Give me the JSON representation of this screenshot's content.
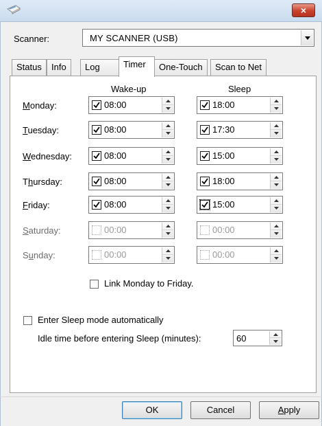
{
  "window": {
    "close_glyph": "×",
    "icon": "scanner-icon"
  },
  "scanner": {
    "label": "Scanner:",
    "value": "MY SCANNER (USB)"
  },
  "tabs": [
    {
      "label": "Status",
      "active": false
    },
    {
      "label": "Info",
      "active": false
    },
    {
      "label": "Log",
      "active": false
    },
    {
      "label": "Timer",
      "active": true
    },
    {
      "label": "One-Touch",
      "active": false
    },
    {
      "label": "Scan to Net",
      "active": false
    }
  ],
  "columns": {
    "wake": "Wake-up",
    "sleep": "Sleep"
  },
  "days": [
    {
      "label": "Monday:",
      "mnemonic": "M",
      "rest": "onday:",
      "enabled": true,
      "wake": {
        "checked": true,
        "value": "08:00"
      },
      "sleep": {
        "checked": true,
        "value": "18:00"
      }
    },
    {
      "label": "Tuesday:",
      "mnemonic": "T",
      "rest": "uesday:",
      "enabled": true,
      "wake": {
        "checked": true,
        "value": "08:00"
      },
      "sleep": {
        "checked": true,
        "value": "17:30"
      }
    },
    {
      "label": "Wednesday:",
      "mnemonic": "W",
      "rest": "ednesday:",
      "enabled": true,
      "wake": {
        "checked": true,
        "value": "08:00"
      },
      "sleep": {
        "checked": true,
        "value": "15:00"
      }
    },
    {
      "label": "Thursday:",
      "mnemonic": "h",
      "pre": "T",
      "rest": "ursday:",
      "enabled": true,
      "wake": {
        "checked": true,
        "value": "08:00"
      },
      "sleep": {
        "checked": true,
        "value": "18:00"
      }
    },
    {
      "label": "Friday:",
      "mnemonic": "F",
      "rest": "riday:",
      "enabled": true,
      "wake": {
        "checked": true,
        "value": "08:00"
      },
      "sleep": {
        "checked": true,
        "value": "15:00",
        "focused": true
      }
    },
    {
      "label": "Saturday:",
      "mnemonic": "S",
      "rest": "aturday:",
      "enabled": false,
      "wake": {
        "checked": false,
        "value": "00:00"
      },
      "sleep": {
        "checked": false,
        "value": "00:00"
      }
    },
    {
      "label": "Sunday:",
      "mnemonic": "u",
      "pre": "S",
      "rest": "nday:",
      "enabled": false,
      "wake": {
        "checked": false,
        "value": "00:00"
      },
      "sleep": {
        "checked": false,
        "value": "00:00"
      }
    }
  ],
  "link_weekdays": {
    "label": "Link Monday to Friday.",
    "checked": false
  },
  "auto_sleep": {
    "label": "Enter Sleep mode automatically",
    "checked": false
  },
  "idle": {
    "label": "Idle time before entering Sleep (minutes):",
    "value": "60"
  },
  "buttons": {
    "ok": "OK",
    "cancel": "Cancel",
    "apply": "Apply"
  }
}
